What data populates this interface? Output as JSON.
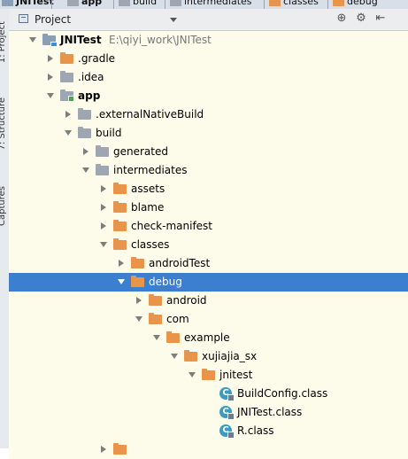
{
  "breadcrumbs": [
    "JNITest",
    "app",
    "build",
    "intermediates",
    "classes",
    "debug"
  ],
  "project_view": {
    "title": "Project",
    "tools": [
      "target-icon",
      "settings-icon",
      "collapse-icon"
    ]
  },
  "side_tabs": [
    "1: Project",
    "7: Structure",
    "Captures"
  ],
  "tree": [
    {
      "label": "JNITest",
      "sub": "E:\\qiyi_work\\JNITest",
      "depth": 0,
      "state": "expanded",
      "icon": "project-folder-icon",
      "bold": true
    },
    {
      "label": ".gradle",
      "depth": 1,
      "state": "collapsed",
      "icon": "orange-folder-icon"
    },
    {
      "label": ".idea",
      "depth": 1,
      "state": "collapsed",
      "icon": "gray-folder-icon"
    },
    {
      "label": "app",
      "depth": 1,
      "state": "expanded",
      "icon": "module-folder-icon",
      "bold": true
    },
    {
      "label": ".externalNativeBuild",
      "depth": 2,
      "state": "collapsed",
      "icon": "gray-folder-icon"
    },
    {
      "label": "build",
      "depth": 2,
      "state": "expanded",
      "icon": "gray-folder-icon"
    },
    {
      "label": "generated",
      "depth": 3,
      "state": "collapsed",
      "icon": "gray-folder-icon"
    },
    {
      "label": "intermediates",
      "depth": 3,
      "state": "expanded",
      "icon": "gray-folder-icon"
    },
    {
      "label": "assets",
      "depth": 4,
      "state": "collapsed",
      "icon": "orange-folder-icon"
    },
    {
      "label": "blame",
      "depth": 4,
      "state": "collapsed",
      "icon": "orange-folder-icon"
    },
    {
      "label": "check-manifest",
      "depth": 4,
      "state": "collapsed",
      "icon": "orange-folder-icon"
    },
    {
      "label": "classes",
      "depth": 4,
      "state": "expanded",
      "icon": "orange-folder-icon"
    },
    {
      "label": "androidTest",
      "depth": 5,
      "state": "collapsed",
      "icon": "orange-folder-icon"
    },
    {
      "label": "debug",
      "depth": 5,
      "state": "expanded",
      "icon": "orange-folder-icon",
      "selected": true
    },
    {
      "label": "android",
      "depth": 6,
      "state": "collapsed",
      "icon": "orange-folder-icon"
    },
    {
      "label": "com",
      "depth": 6,
      "state": "expanded",
      "icon": "orange-folder-icon"
    },
    {
      "label": "example",
      "depth": 7,
      "state": "expanded",
      "icon": "orange-folder-icon"
    },
    {
      "label": "xujiajia_sx",
      "depth": 8,
      "state": "expanded",
      "icon": "orange-folder-icon"
    },
    {
      "label": "jnitest",
      "depth": 9,
      "state": "expanded",
      "icon": "orange-folder-icon"
    },
    {
      "label": "BuildConfig.class",
      "depth": 10,
      "state": "leaf",
      "icon": "class-file-icon"
    },
    {
      "label": "JNITest.class",
      "depth": 10,
      "state": "leaf",
      "icon": "class-file-icon"
    },
    {
      "label": "R.class",
      "depth": 10,
      "state": "leaf",
      "icon": "class-file-icon"
    },
    {
      "label": "",
      "depth": 4,
      "state": "collapsed",
      "icon": "orange-folder-icon"
    }
  ],
  "colors": {
    "selection": "#3c7fcf",
    "row_background": "#fdfbea",
    "folder_orange": "#e8944b",
    "folder_gray": "#9ea7b1",
    "class_icon": "#3a9cc2"
  }
}
